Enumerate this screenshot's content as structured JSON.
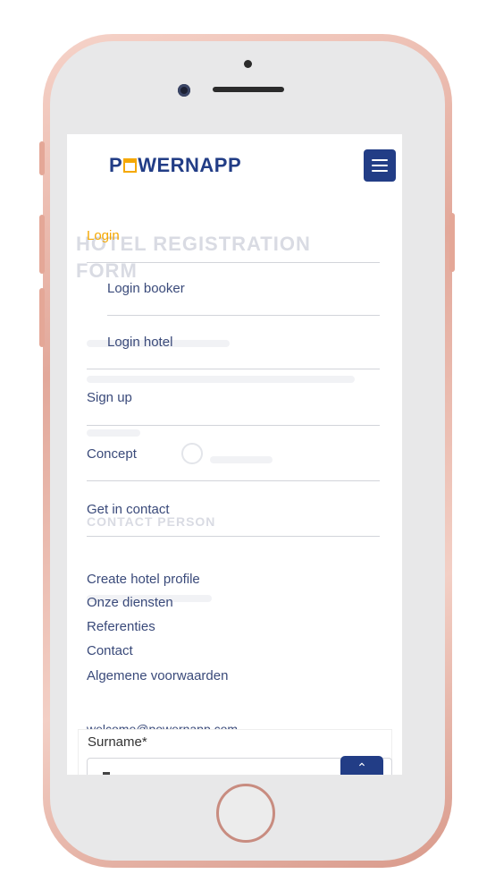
{
  "header": {
    "logo_text": "POWERNAPP",
    "logo_letter_p": "P",
    "logo_rest": "WERNAPP",
    "menu_icon": "hamburger-icon"
  },
  "background": {
    "title": "HOTEL REGISTRATION FORM",
    "contact_heading": "CONTACT PERSON"
  },
  "nav": {
    "items": [
      {
        "label": "Login",
        "active": true
      },
      {
        "label": "Login booker"
      },
      {
        "label": "Login hotel"
      },
      {
        "label": "Sign up"
      },
      {
        "label": "Concept"
      },
      {
        "label": "Get in contact"
      }
    ],
    "footer_links": [
      "Create hotel profile",
      "Onze diensten",
      "Referenties",
      "Contact",
      "Algemene voorwaarden"
    ],
    "email": "welcome@powernapp.com"
  },
  "form": {
    "surname_label": "Surname*"
  },
  "scroll_top": {
    "icon": "chevron-up-icon",
    "glyph": "⌃"
  },
  "colors": {
    "brand": "#223d86",
    "accent": "#f5a800",
    "frame": "#e2a89a"
  }
}
